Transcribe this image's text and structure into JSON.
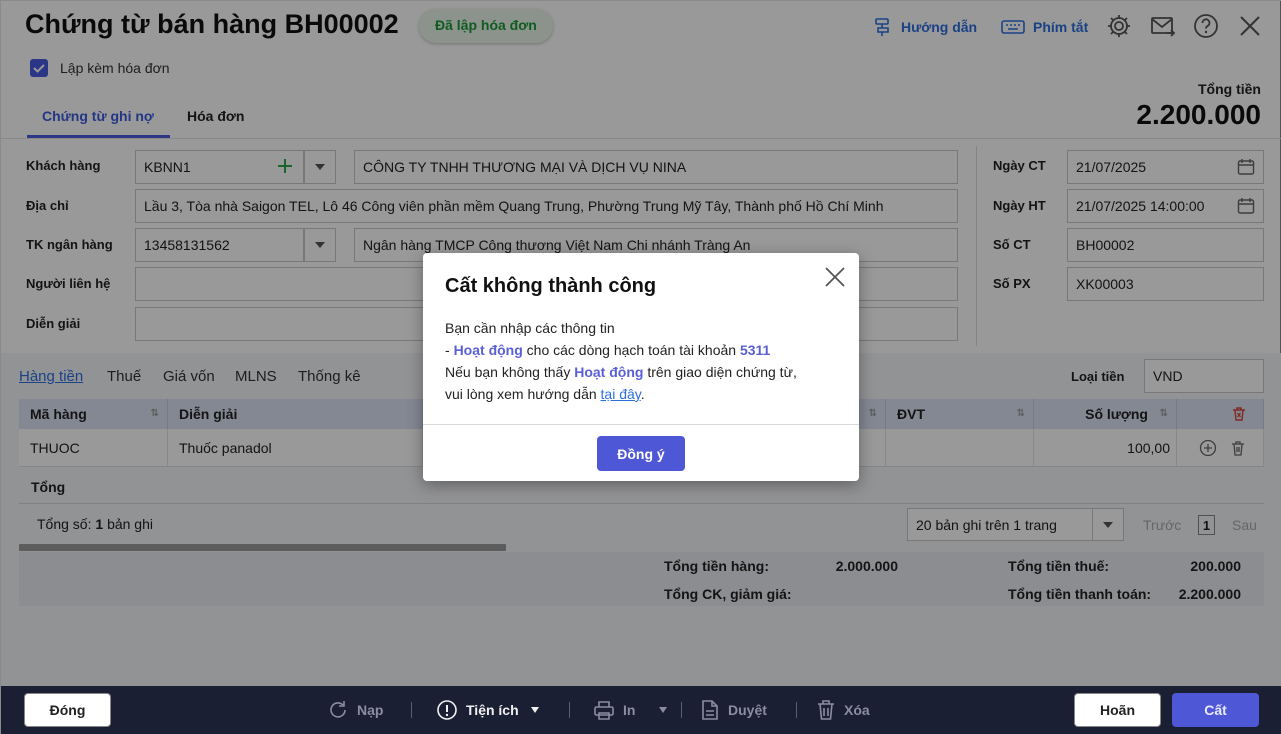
{
  "header": {
    "title": "Chứng từ bán hàng BH00002",
    "status": "Đã lập hóa đơn",
    "guide_label": "Hướng dẫn",
    "shortcut_label": "Phím tắt",
    "invoice_checkbox_label": "Lập kèm hóa đơn",
    "invoice_checkbox_checked": true,
    "total_label": "Tổng tiền",
    "total_value": "2.200.000"
  },
  "tabs": [
    {
      "label": "Chứng từ ghi nợ",
      "active": true
    },
    {
      "label": "Hóa đơn",
      "active": false
    }
  ],
  "form": {
    "customer_label": "Khách hàng",
    "customer_code": "KBNN1",
    "customer_name": "CÔNG TY TNHH THƯƠNG MẠI VÀ DỊCH VỤ NINA",
    "address_label": "Địa chỉ",
    "address": "Lầu 3, Tòa nhà Saigon TEL, Lô 46 Công viên phần mềm Quang Trung, Phường Trung Mỹ Tây, Thành phố Hồ Chí Minh",
    "bank_label": "TK ngân hàng",
    "bank_account": "13458131562",
    "bank_name": "Ngân hàng TMCP Công thương Việt Nam Chi nhánh Tràng An",
    "contact_label": "Người liên hệ",
    "contact": "",
    "description_label": "Diễn giải",
    "description": "",
    "doc_date_label": "Ngày CT",
    "doc_date": "21/07/2025",
    "post_date_label": "Ngày HT",
    "post_date": "21/07/2025 14:00:00",
    "doc_no_label": "Số CT",
    "doc_no": "BH00002",
    "px_no_label": "Số PX",
    "px_no": "XK00003"
  },
  "detail_tabs": [
    "Hàng tiền",
    "Thuế",
    "Giá vốn",
    "MLNS",
    "Thống kê"
  ],
  "currency": {
    "label": "Loại tiền",
    "value": "VND"
  },
  "table": {
    "columns": [
      "Mã hàng",
      "Diễn giải",
      "ĐVT",
      "Số lượng"
    ],
    "rows": [
      {
        "code": "THUOC",
        "desc": "Thuốc panadol",
        "unit": "",
        "qty": "100,00"
      }
    ],
    "total_label": "Tổng",
    "record_count_prefix": "Tổng số:",
    "record_count": "1",
    "record_count_suffix": "bản ghi",
    "page_size": "20 bản ghi trên 1 trang",
    "prev": "Trước",
    "page": "1",
    "next": "Sau"
  },
  "summary": {
    "goods_label": "Tổng tiền hàng:",
    "goods_value": "2.000.000",
    "discount_label": "Tổng CK, giảm giá:",
    "discount_value": "",
    "tax_label": "Tổng tiền thuế:",
    "tax_value": "200.000",
    "pay_label": "Tổng tiền thanh toán:",
    "pay_value": "2.200.000"
  },
  "footer": {
    "close": "Đóng",
    "reload": "Nạp",
    "utilities": "Tiện ích",
    "print": "In",
    "approve": "Duyệt",
    "delete": "Xóa",
    "undo": "Hoãn",
    "save": "Cất"
  },
  "dialog": {
    "title": "Cất không thành công",
    "line1": "Bạn cần nhập các thông tin",
    "line2_prefix": "- ",
    "line2_hl": "Hoạt động",
    "line2_mid": " cho các dòng hạch toán tài khoản ",
    "line2_acc": "5311",
    "line3_prefix": "Nếu bạn không thấy ",
    "line3_hl": "Hoạt động",
    "line3_suffix": " trên giao diện chứng từ,",
    "line4_prefix": "vui lòng xem hướng dẫn ",
    "line4_link": "tại đây",
    "line4_suffix": ".",
    "ok": "Đồng ý"
  },
  "colors": {
    "accent": "#4e57d6",
    "link": "#2d6ee0",
    "status_green": "#1c9a35",
    "footer_bg": "#1b1f33"
  }
}
